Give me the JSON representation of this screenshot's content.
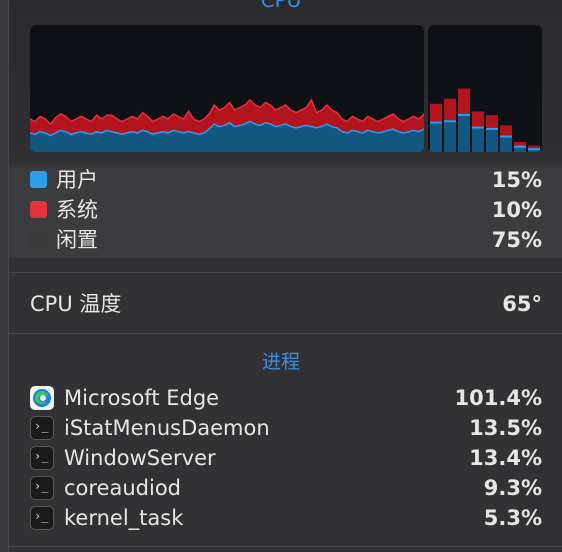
{
  "cpu": {
    "title": "CPU",
    "colors": {
      "user": "#2d9cf0",
      "system": "#e6323a",
      "idle": "#3a3a3a"
    },
    "legend": [
      {
        "label": "用户",
        "value": "15%"
      },
      {
        "label": "系统",
        "value": "10%"
      },
      {
        "label": "闲置",
        "value": "75%"
      }
    ],
    "history_user": [
      15,
      14,
      16,
      15,
      13,
      15,
      17,
      16,
      14,
      15,
      16,
      15,
      14,
      16,
      15,
      17,
      16,
      15,
      14,
      15,
      16,
      15,
      17,
      16,
      14,
      15,
      16,
      15,
      17,
      16,
      15,
      16,
      15,
      14,
      15,
      18,
      22,
      20,
      21,
      23,
      20,
      21,
      22,
      24,
      22,
      21,
      23,
      22,
      20,
      21,
      22,
      20,
      19,
      20,
      21,
      20,
      19,
      20,
      22,
      20,
      19,
      16,
      15,
      17,
      16,
      15,
      17,
      16,
      15,
      16,
      17,
      18,
      16,
      15,
      16,
      17,
      16,
      18
    ],
    "history_system": [
      11,
      10,
      12,
      11,
      9,
      12,
      13,
      12,
      10,
      11,
      12,
      11,
      10,
      13,
      11,
      12,
      13,
      11,
      10,
      11,
      12,
      11,
      14,
      12,
      10,
      11,
      12,
      11,
      13,
      12,
      11,
      16,
      11,
      10,
      11,
      12,
      15,
      13,
      14,
      16,
      13,
      14,
      15,
      17,
      15,
      14,
      16,
      15,
      13,
      14,
      15,
      13,
      12,
      13,
      14,
      21,
      12,
      13,
      15,
      13,
      12,
      10,
      9,
      11,
      10,
      9,
      11,
      10,
      9,
      10,
      11,
      12,
      10,
      9,
      10,
      11,
      10,
      12
    ],
    "hist_user": [
      24,
      25,
      30,
      20,
      19,
      13,
      5,
      3
    ],
    "hist_system": [
      14,
      17,
      20,
      12,
      10,
      8,
      3,
      2
    ]
  },
  "temperature": {
    "label": "CPU 温度",
    "value": "65°"
  },
  "processes": {
    "title": "进程",
    "items": [
      {
        "name": "Microsoft Edge",
        "value": "101.4%",
        "icon": "edge-icon"
      },
      {
        "name": "iStatMenusDaemon",
        "value": "13.5%",
        "icon": "terminal-icon"
      },
      {
        "name": "WindowServer",
        "value": "13.4%",
        "icon": "terminal-icon"
      },
      {
        "name": "coreaudiod",
        "value": "9.3%",
        "icon": "terminal-icon"
      },
      {
        "name": "kernel_task",
        "value": "5.3%",
        "icon": "terminal-icon"
      }
    ]
  }
}
